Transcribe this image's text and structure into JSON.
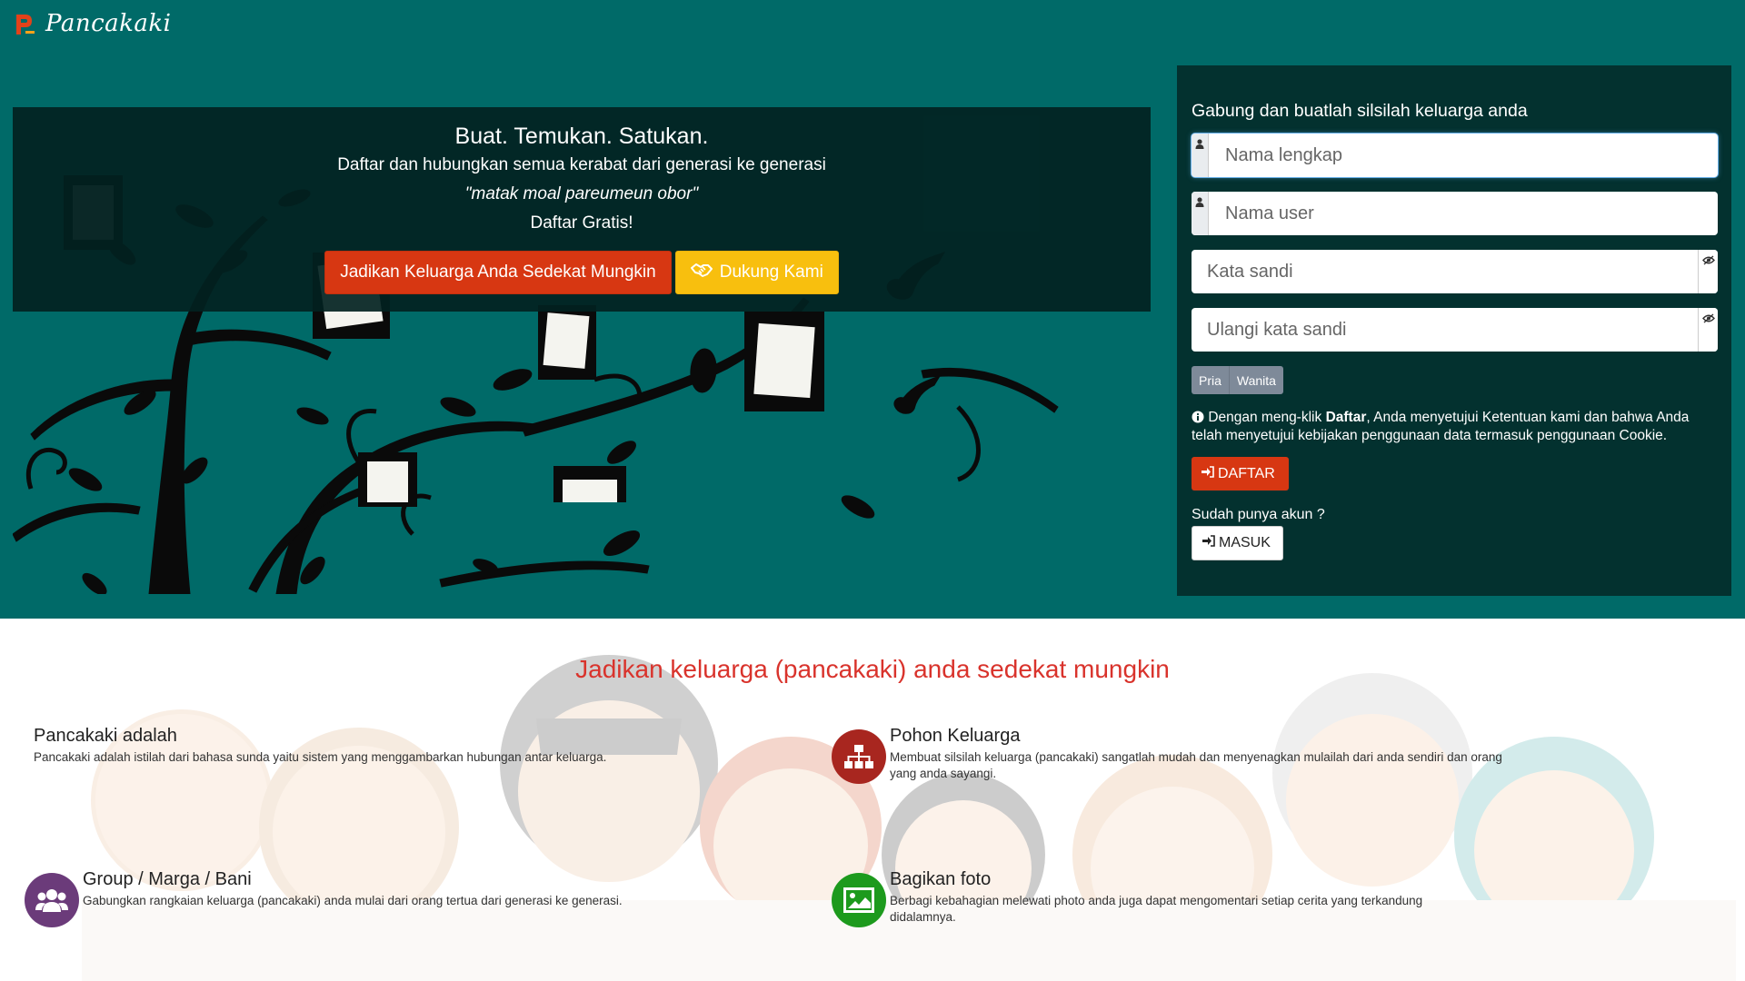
{
  "brand": {
    "name": "Pancakaki"
  },
  "hero": {
    "title": "Buat. Temukan. Satukan.",
    "subtitle": "Daftar dan hubungkan semua kerabat dari generasi ke generasi",
    "quote": "\"matak moal pareumeun obor\"",
    "cta_text": "Daftar Gratis!",
    "primary_button": "Jadikan Keluarga Anda Sedekat Mungkin",
    "support_button": "Dukung Kami"
  },
  "register": {
    "title": "Gabung dan buatlah silsilah keluarga anda",
    "fullname_placeholder": "Nama lengkap",
    "username_placeholder": "Nama user",
    "password_placeholder": "Kata sandi",
    "password_confirm_placeholder": "Ulangi kata sandi",
    "gender_male": "Pria",
    "gender_female": "Wanita",
    "terms_prefix": "Dengan meng-klik",
    "terms_bold": "Daftar",
    "terms_suffix": ", Anda menyetujui Ketentuan kami dan bahwa Anda telah menyetujui kebijakan penggunaan data termasuk penggunaan Cookie.",
    "register_button": "DAFTAR",
    "have_account": "Sudah punya akun ?",
    "login_button": "MASUK"
  },
  "features": {
    "section_title": "Jadikan keluarga (pancakaki) anda sedekat mungkin",
    "items": [
      {
        "title": "Pancakaki adalah",
        "text": "Pancakaki adalah istilah dari bahasa sunda yaitu sistem yang menggambarkan hubungan antar keluarga.",
        "icon": ""
      },
      {
        "title": "Pohon Keluarga",
        "text": "Membuat silsilah keluarga (pancakaki) sangatlah mudah dan menyenagkan mulailah dari anda sendiri dan orang yang anda sayangi.",
        "icon": "sitemap-icon",
        "color": "#a8261f"
      },
      {
        "title": "Group / Marga / Bani",
        "text": "Gabungkan rangkaian keluarga (pancakaki) anda mulai dari orang tertua dari generasi ke generasi.",
        "icon": "users-icon",
        "color": "#6b3b7a"
      },
      {
        "title": "Bagikan foto",
        "text": "Berbagi kebahagian melewati photo anda juga dapat mengomentari setiap cerita yang terkandung didalamnya.",
        "icon": "image-icon",
        "color": "#1d9a1d"
      }
    ]
  },
  "colors": {
    "teal": "#006a68",
    "panel": "#03312f",
    "red": "#d73712",
    "yellow": "#f8bf0e",
    "title_red": "#d9332c"
  }
}
